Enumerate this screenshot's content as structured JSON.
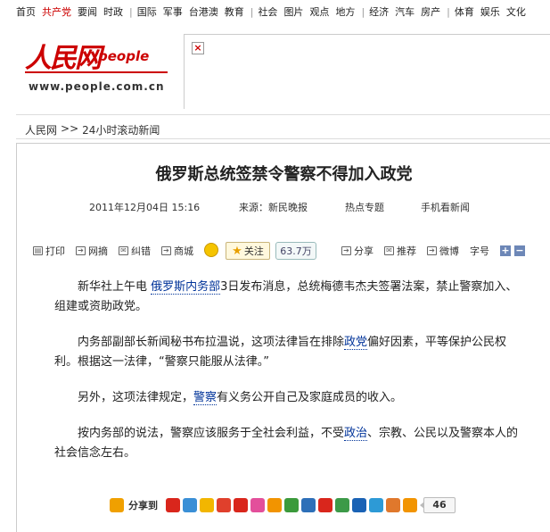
{
  "topnav": {
    "items": [
      "首页",
      "共产党",
      "要闻",
      "时政",
      "|",
      "国际",
      "军事",
      "台港澳",
      "教育",
      "|",
      "社会",
      "图片",
      "观点",
      "地方",
      "|",
      "经济",
      "汽车",
      "房产",
      "|",
      "体育",
      "娱乐",
      "文化"
    ]
  },
  "logo": {
    "cn": "人民网",
    "en": "people",
    "url": "www.people.com.cn"
  },
  "breadcrumb": {
    "home": "人民网",
    "sep": ">>",
    "section": "24小时滚动新闻"
  },
  "article": {
    "title": "俄罗斯总统签禁令警察不得加入政党",
    "date": "2011年12月04日  15:16",
    "source": "来源：新民晚报",
    "hot_topics": "热点专题",
    "mobile": "手机看新闻",
    "paragraphs": [
      {
        "before": "新华社上午电 ",
        "link": "俄罗斯内务部",
        "after": "3日发布消息，总统梅德韦杰夫签署法案，禁止警察加入、组建或资助政党。"
      },
      {
        "before": "内务部副部长新闻秘书布拉温说，这项法律旨在排除",
        "link": "政党",
        "after": "偏好因素，平等保护公民权利。根据这一法律，“警察只能服从法律。”"
      },
      {
        "before": "另外，这项法律规定，",
        "link": "警察",
        "after": "有义务公开自己及家庭成员的收入。"
      },
      {
        "before": "按内务部的说法，警察应该服务于全社会利益，不受",
        "link": "政治",
        "after": "、宗教、公民以及警察本人的社会信念左右。"
      }
    ]
  },
  "toolbar": {
    "print": "打印",
    "bookmark": "网摘",
    "error": "纠错",
    "shop": "商城",
    "follow": "关注",
    "follow_count": "63.7万",
    "share": "分享",
    "recommend": "推荐",
    "weibo": "微博",
    "font_size": "字号",
    "plus": "+",
    "minus": "−"
  },
  "sharebar": {
    "label": "分享到",
    "count": "46",
    "icon_colors": [
      "#d9261c",
      "#3a8fd6",
      "#f2b600",
      "#e0402c",
      "#d9261c",
      "#e34f9b",
      "#f29400",
      "#3b9a3b",
      "#2d6fb8",
      "#d9261c",
      "#3c9a48",
      "#1a62b5",
      "#2d9ad6",
      "#e0782c",
      "#f29400"
    ]
  },
  "colors": {
    "brand_red": "#cc0000",
    "link_blue": "#003399"
  }
}
